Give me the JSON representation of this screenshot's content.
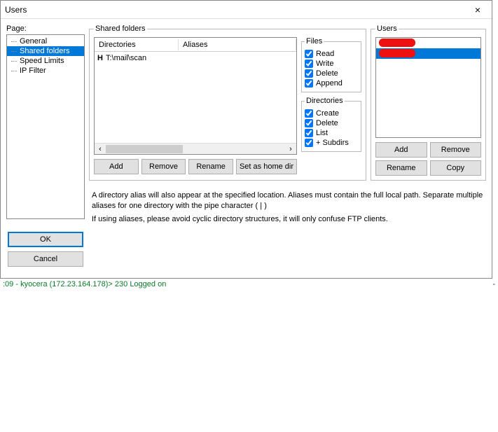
{
  "window": {
    "title": "Users",
    "close_label": "×"
  },
  "page": {
    "label": "Page:",
    "items": [
      {
        "label": "General",
        "selected": false
      },
      {
        "label": "Shared folders",
        "selected": true
      },
      {
        "label": "Speed Limits",
        "selected": false
      },
      {
        "label": "IP Filter",
        "selected": false
      }
    ]
  },
  "shared": {
    "legend": "Shared folders",
    "headers": {
      "dir": "Directories",
      "alias": "Aliases"
    },
    "rows": [
      {
        "icon": "H",
        "path": "T:\\mail\\scan",
        "alias": ""
      }
    ],
    "buttons": {
      "add": "Add",
      "remove": "Remove",
      "rename": "Rename",
      "sethome": "Set as home dir"
    }
  },
  "perms": {
    "files": {
      "legend": "Files",
      "items": [
        {
          "label": "Read",
          "checked": true
        },
        {
          "label": "Write",
          "checked": true
        },
        {
          "label": "Delete",
          "checked": true
        },
        {
          "label": "Append",
          "checked": true
        }
      ]
    },
    "dirs": {
      "legend": "Directories",
      "items": [
        {
          "label": "Create",
          "checked": true
        },
        {
          "label": "Delete",
          "checked": true
        },
        {
          "label": "List",
          "checked": true
        },
        {
          "label": "+ Subdirs",
          "checked": true
        }
      ]
    }
  },
  "users": {
    "legend": "Users",
    "list": [
      {
        "selected": false
      },
      {
        "selected": true
      }
    ],
    "buttons": {
      "add": "Add",
      "remove": "Remove",
      "rename": "Rename",
      "copy": "Copy"
    }
  },
  "help": {
    "line1": "A directory alias will also appear at the specified location. Aliases must contain the full local path. Separate multiple aliases for one directory with the pipe character ( | )",
    "line2": "If using aliases, please avoid cyclic directory structures, it will only confuse FTP clients."
  },
  "footer": {
    "ok": "OK",
    "cancel": "Cancel"
  },
  "status": {
    "text": ":09 - kyocera (172.23.164.178)> 230 Logged on",
    "dash": "-"
  }
}
